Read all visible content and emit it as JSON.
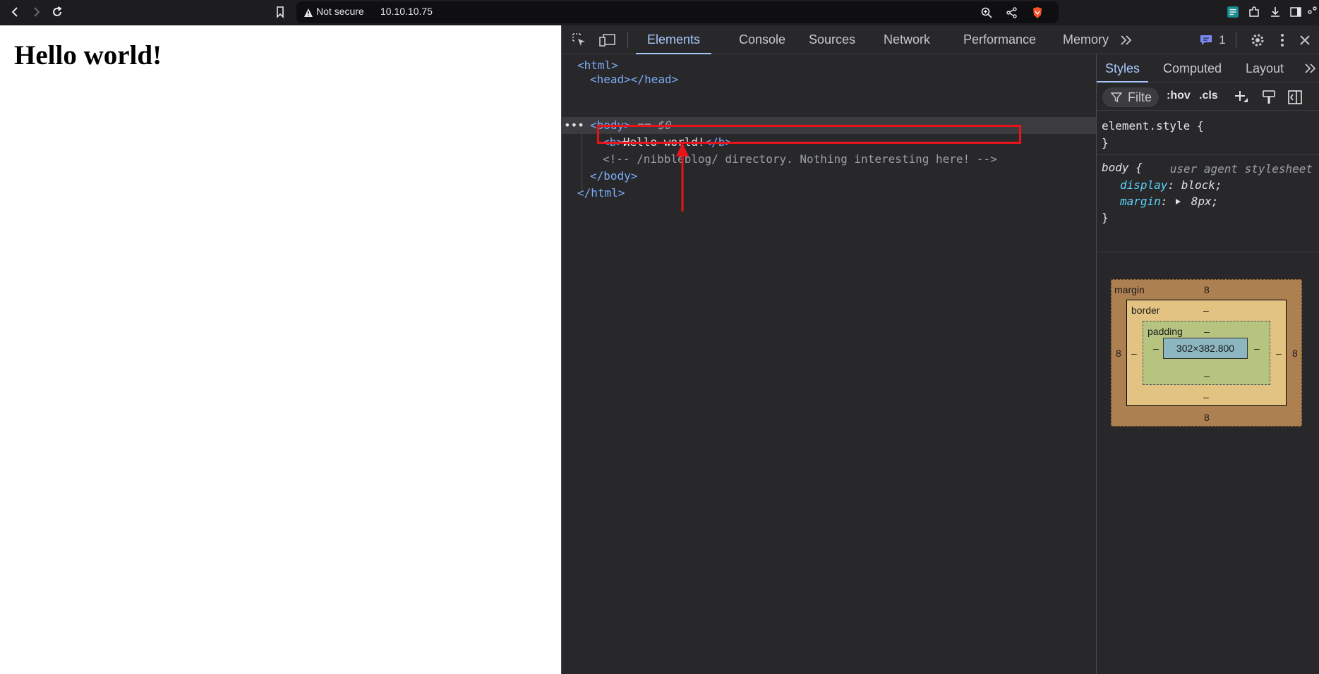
{
  "browser": {
    "url_warning": "Not secure",
    "url_host": "10.10.10.75"
  },
  "page": {
    "heading": "Hello world!"
  },
  "devtools": {
    "tabs": [
      "Elements",
      "Console",
      "Sources",
      "Network",
      "Performance",
      "Memory"
    ],
    "active_tab": "Elements",
    "issues_count": "1",
    "dom_tree": {
      "html_open": "<html>",
      "head": "<head></head>",
      "body_open": "<body>",
      "body_marker": "== $0",
      "b_open": "<b>",
      "b_text": "Hello world!",
      "b_close": "</b>",
      "comment": "<!-- /nibbleblog/ directory. Nothing interesting here! -->",
      "body_close": "</body>",
      "html_close": "</html>",
      "ellipsis": "•••"
    },
    "styles_pane": {
      "tabs": [
        "Styles",
        "Computed",
        "Layout"
      ],
      "active_tab": "Styles",
      "filter_placeholder": "Filte",
      "hov_label": ":hov",
      "cls_label": ".cls",
      "element_style_selector": "element.style {",
      "close_brace": "}",
      "body_selector": "body {",
      "user_agent_label": "user agent stylesheet",
      "display_prop": "display",
      "display_value": "block;",
      "margin_prop": "margin",
      "margin_value": "8px;"
    },
    "box_model": {
      "margin_label": "margin",
      "margin_top": "8",
      "margin_bottom": "8",
      "margin_left": "8",
      "margin_right": "8",
      "border_label": "border",
      "border_top": "–",
      "border_bottom": "–",
      "border_left": "–",
      "border_right": "–",
      "padding_label": "padding",
      "padding_top": "–",
      "padding_bottom": "–",
      "padding_left": "–",
      "padding_right": "–",
      "content_size": "302×382.800"
    }
  },
  "colors": {
    "highlight_box": "#e8141b",
    "devtools_bg": "#28282b",
    "tag_color": "#7cacf8",
    "active_tab": "#a8c7fa"
  }
}
